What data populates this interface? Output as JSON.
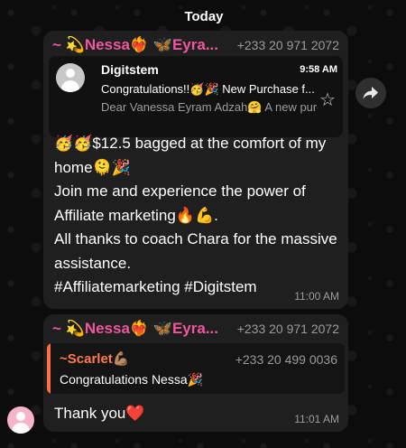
{
  "date_divider": "Today",
  "message1": {
    "sender_name": "~ 💫Nessa❤️‍🔥 🦋Eyra...",
    "sender_phone": "+233 20 971 2072",
    "email_preview": {
      "sender": "Digitstem",
      "time": "9:58 AM",
      "subject": "Congratulations!!🥳🎉 New Purchase f...",
      "snippet": "Dear Vanessa Eyram Adzah🤗 A new purc..."
    },
    "text": "🥳🥳$12.5 bagged at the comfort of my home🫠🎉\nJoin me and experience the power of Affiliate marketing🔥💪.\nAll thanks to coach Chara for the massive assistance.\n#Affiliatemarketing #Digitstem",
    "time": "11:00 AM"
  },
  "message2": {
    "sender_name": "~ 💫Nessa❤️‍🔥 🦋Eyra...",
    "sender_phone": "+233 20 971 2072",
    "quoted": {
      "name": "~Scarlet💪🏽",
      "phone": "+233 20 499 0036",
      "text": "Congratulations Nessa🎉"
    },
    "text": "Thank you❤️",
    "time": "11:01 AM"
  },
  "icons": {
    "forward": "forward-arrow-icon",
    "star": "star-outline-icon",
    "avatar": "default-avatar-icon"
  },
  "colors": {
    "sender_name": "#f0569d",
    "quote_accent": "#ff7043",
    "bubble": "#1f1f1f"
  }
}
